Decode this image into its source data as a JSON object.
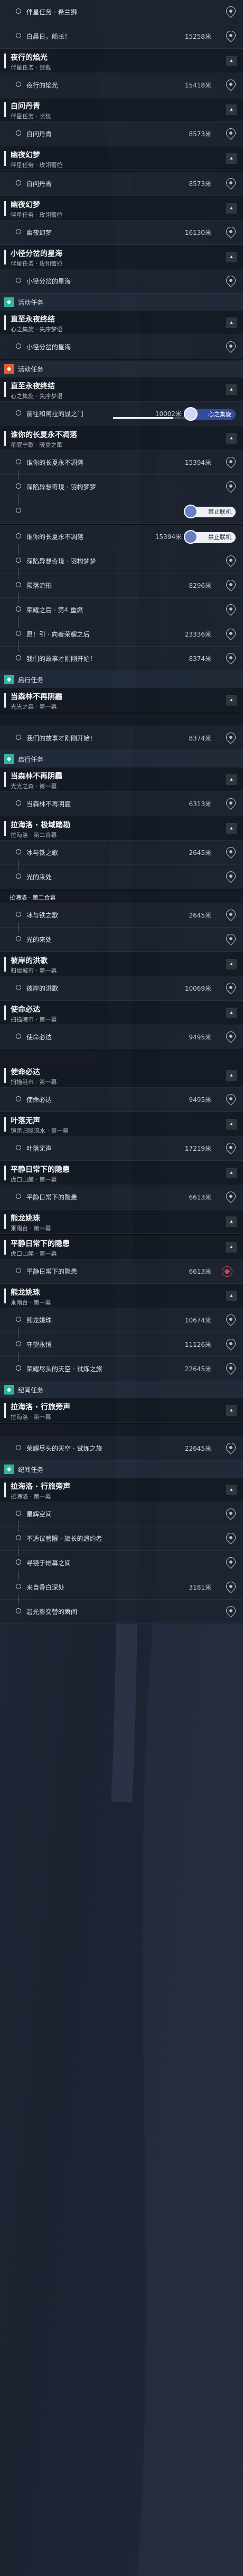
{
  "colors": {
    "accent_orange": "#e25b38",
    "accent_teal": "#33b39a",
    "pill_blue": "#314c9f",
    "panel_dark": "#121822"
  },
  "icons": {
    "collapse": "chevron-up-icon",
    "step_marker": "circle-icon",
    "locate": "map-pin-icon",
    "tracked": "diamond-target-icon",
    "event_badge": "flame-badge-icon",
    "travel_badge": "compass-badge-icon"
  },
  "screens": [
    [
      {
        "type": "step",
        "label": "伴星任务 · 希兰狮",
        "dist": "",
        "conn": false
      },
      {
        "type": "step",
        "label": "白晨日，船长！",
        "dist": "15258米",
        "conn": false
      },
      {
        "type": "quest",
        "title": "夜行的焰光",
        "subtitle": "伴星任务 · 贺戴",
        "chevron": "▴"
      },
      {
        "type": "step",
        "label": "夜行的焰光",
        "dist": "15418米",
        "conn": false
      },
      {
        "type": "quest",
        "title": "白问丹青",
        "subtitle": "伴星任务 · 长枝",
        "chevron": "▴"
      },
      {
        "type": "step",
        "label": "白问丹青",
        "dist": "8573米",
        "conn": false
      },
      {
        "type": "quest",
        "title": "幽夜幻梦",
        "subtitle": "伴星任务 · 玫翎蕾拉",
        "chevron": "▴"
      }
    ],
    [
      {
        "type": "step",
        "label": "白问丹青",
        "dist": "8573米",
        "conn": false
      },
      {
        "type": "quest",
        "title": "幽夜幻梦",
        "subtitle": "伴星任务 · 玫翎蕾拉",
        "chevron": "▴"
      },
      {
        "type": "step",
        "label": "幽夜幻梦",
        "dist": "16130米",
        "conn": false
      },
      {
        "type": "quest",
        "title": "小径分岔的星海",
        "subtitle": "伴星任务 · 玫翎蕾拉",
        "chevron": "▴"
      },
      {
        "type": "step",
        "label": "小径分岔的星海",
        "dist": "",
        "conn": false
      },
      {
        "type": "header",
        "label": "活动任务",
        "badge": "teal"
      },
      {
        "type": "quest",
        "title": "直至永夜终结",
        "subtitle": "心之集旋 · 失序梦语",
        "chevron": "▴"
      },
      {
        "type": "step",
        "label": "小径分岔的星海",
        "dist": "",
        "conn": false
      }
    ],
    [
      {
        "type": "header",
        "label": "活动任务",
        "badge": "orange"
      },
      {
        "type": "quest",
        "title": "直至永夜终结",
        "subtitle": "心之集旋 · 失序梦语",
        "chevron": "▴"
      },
      {
        "type": "step",
        "label": "前往和阿拉的显之门",
        "dist": "10002米",
        "conn": false,
        "pill": "心之集旋",
        "progress": 0.75
      },
      {
        "type": "quest",
        "title": "谁你的长夏永不凋落",
        "subtitle": "星眠宁歌 · 暖盒之歌",
        "chevron": "▴"
      },
      {
        "type": "step",
        "label": "谁你的长夏永不凋落",
        "dist": "15394米",
        "conn": false
      },
      {
        "type": "step",
        "label": "深陷异想奇境 · 羽构梦梦",
        "dist": "",
        "conn": true
      },
      {
        "type": "step",
        "label": "",
        "dist": "",
        "conn": true,
        "pill": "禁止联机",
        "pill_style": "white"
      }
    ],
    [
      {
        "type": "step",
        "label": "谁你的长夏永不凋落",
        "dist": "15394米",
        "conn": false,
        "pill": "禁止联机",
        "pill_style": "white",
        "mark": true
      },
      {
        "type": "step",
        "label": "深陷异想奇境 · 羽构梦梦",
        "dist": "",
        "conn": true
      },
      {
        "type": "step",
        "label": "陨落流形",
        "dist": "8296米",
        "conn": true
      },
      {
        "type": "step",
        "label": "荣耀之后 · 第4 重燃",
        "dist": "",
        "conn": true
      },
      {
        "type": "step",
        "label": "愿！引 · 向着荣耀之后",
        "dist": "23336米",
        "conn": true
      },
      {
        "type": "step",
        "label": "我们的故事才刚刚开始！",
        "dist": "8374米",
        "conn": true
      },
      {
        "type": "header",
        "label": "启行任务",
        "badge": "teal"
      },
      {
        "type": "quest",
        "title": "当森林不再阴霾",
        "subtitle": "光光之森 · 第一幕",
        "chevron": "▴"
      }
    ],
    [
      {
        "type": "strip",
        "label": "",
        "conn": false
      },
      {
        "type": "step",
        "label": "我们的故事才刚刚开始！",
        "dist": "8374米",
        "conn": false
      },
      {
        "type": "header",
        "label": "启行任务",
        "badge": "teal"
      },
      {
        "type": "quest",
        "title": "当森林不再阴霾",
        "subtitle": "光光之森 · 第一幕",
        "chevron": "▴"
      },
      {
        "type": "step",
        "label": "当森林不再阴霾",
        "dist": "6313米",
        "conn": false
      },
      {
        "type": "quest",
        "title": "拉海洛 · 极域踏勘",
        "subtitle": "拉海洛 · 第二合幕",
        "chevron": "▴"
      },
      {
        "type": "step",
        "label": "冰与铁之歌",
        "dist": "2645米",
        "conn": false
      },
      {
        "type": "step",
        "label": "光的来处",
        "dist": "",
        "conn": true
      }
    ],
    [
      {
        "type": "strip",
        "label": "拉海洛 · 第二合幕",
        "conn": false
      },
      {
        "type": "step",
        "label": "冰与铁之歌",
        "dist": "2645米",
        "conn": false
      },
      {
        "type": "step",
        "label": "光的来处",
        "dist": "",
        "conn": true
      },
      {
        "type": "quest",
        "title": "彼岸的洪歌",
        "subtitle": "归墟城市 · 第一幕",
        "chevron": "▴"
      },
      {
        "type": "step",
        "label": "彼岸的洪歌",
        "dist": "10069米",
        "conn": false
      },
      {
        "type": "quest",
        "title": "使命必达",
        "subtitle": "扫描港市 · 第一幕",
        "chevron": "▴"
      },
      {
        "type": "step",
        "label": "使命必达",
        "dist": "9495米",
        "conn": false
      }
    ],
    [
      {
        "type": "strip",
        "label": "",
        "conn": false
      },
      {
        "type": "quest",
        "title": "使命必达",
        "subtitle": "扫描港市 · 第一幕",
        "chevron": "▴"
      },
      {
        "type": "step",
        "label": "使命必达",
        "dist": "9495米",
        "conn": false
      },
      {
        "type": "quest",
        "title": "叶落无声",
        "subtitle": "镜黑归隐流水 · 第一幕",
        "chevron": "▴"
      },
      {
        "type": "step",
        "label": "叶落无声",
        "dist": "17219米",
        "conn": false
      },
      {
        "type": "quest",
        "title": "平静日常下的隐患",
        "subtitle": "虎口山麓 · 第一幕",
        "chevron": "▴"
      },
      {
        "type": "step",
        "label": "平静日常下的隐患",
        "dist": "6613米",
        "conn": false
      },
      {
        "type": "quest",
        "title": "熊龙姚珠",
        "subtitle": "乘雨台 · 第一幕",
        "chevron": "▴"
      }
    ],
    [
      {
        "type": "quest",
        "title": "平静日常下的隐患",
        "subtitle": "虎口山麓 · 第一幕",
        "chevron": "▴"
      },
      {
        "type": "step",
        "label": "平静日常下的隐患",
        "dist": "6613米",
        "conn": false,
        "mark": true
      },
      {
        "type": "quest",
        "title": "熊龙姚珠",
        "subtitle": "乘雨台 · 第一幕",
        "chevron": "▴"
      },
      {
        "type": "step",
        "label": "熊龙姚珠",
        "dist": "10674米",
        "conn": false
      },
      {
        "type": "step",
        "label": "守望永恒",
        "dist": "11126米",
        "conn": true
      },
      {
        "type": "step",
        "label": "荣耀尽头的天空 · 试炼之旅",
        "dist": "22645米",
        "conn": true
      },
      {
        "type": "header",
        "label": "纪闻任务",
        "badge": "teal"
      },
      {
        "type": "quest",
        "title": "拉海洛 · 行旅旁声",
        "subtitle": "拉海洛 · 第一幕",
        "chevron": "▴"
      }
    ],
    [
      {
        "type": "strip",
        "label": "",
        "conn": false
      },
      {
        "type": "step",
        "label": "荣耀尽头的天空 · 试炼之旅",
        "dist": "22645米",
        "conn": false
      },
      {
        "type": "header",
        "label": "纪闻任务",
        "badge": "teal"
      },
      {
        "type": "quest",
        "title": "拉海洛 · 行旅旁声",
        "subtitle": "拉海洛 · 第一幕",
        "chevron": "▴"
      },
      {
        "type": "step",
        "label": "星辉空间",
        "dist": "",
        "conn": false
      },
      {
        "type": "step",
        "label": "不适议管限 · 旅长的遗约者",
        "dist": "",
        "conn": true
      },
      {
        "type": "step",
        "label": "寻镜于帷幕之间",
        "dist": "",
        "conn": true
      },
      {
        "type": "step",
        "label": "来自骨白深处",
        "dist": "3181米",
        "conn": true
      },
      {
        "type": "step",
        "label": "碧光影交替的瞬间",
        "dist": "",
        "conn": true
      }
    ]
  ]
}
